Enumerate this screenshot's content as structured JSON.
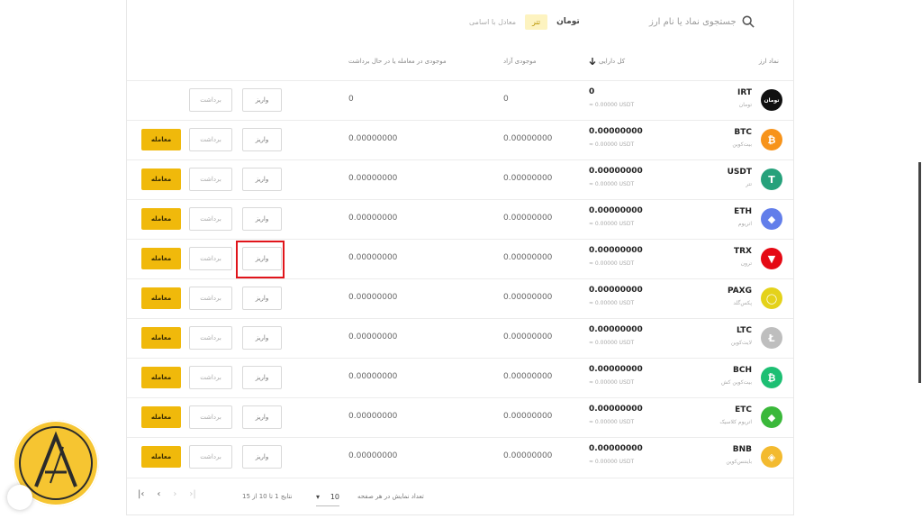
{
  "search": {
    "placeholder": "جستجوی نماد یا نام ارز"
  },
  "filters": [
    {
      "label": "معادل با اسامی",
      "active": false
    },
    {
      "label": "تتر",
      "active": true
    },
    {
      "label": "تومان",
      "active": false
    }
  ],
  "columns": {
    "coin": "نماد ارز",
    "total": "کل دارایی",
    "blocked": "موجودی آزاد",
    "available": "موجودی در معامله یا در حال برداشت"
  },
  "buttons": {
    "deposit": "واریز",
    "withdraw": "برداشت",
    "trade": "معامله"
  },
  "rows": [
    {
      "symbol": "IRT",
      "name": "تومان",
      "balance": "0",
      "sub": "≈ 0.00000 USDT",
      "blocked": "0",
      "available": "0",
      "color": "#111111",
      "glyph": "تومان",
      "trade": false
    },
    {
      "symbol": "BTC",
      "name": "بیت‌کوین",
      "balance": "0.00000000",
      "sub": "≈ 0.00000 USDT",
      "blocked": "0.00000000",
      "available": "0.00000000",
      "color": "#f7931a",
      "glyph": "₿",
      "trade": true
    },
    {
      "symbol": "USDT",
      "name": "تتر",
      "balance": "0.00000000",
      "sub": "≈ 0.00000 USDT",
      "blocked": "0.00000000",
      "available": "0.00000000",
      "color": "#26a17b",
      "glyph": "T",
      "trade": true
    },
    {
      "symbol": "ETH",
      "name": "اتریوم",
      "balance": "0.00000000",
      "sub": "≈ 0.00000 USDT",
      "blocked": "0.00000000",
      "available": "0.00000000",
      "color": "#627eea",
      "glyph": "◆",
      "trade": true
    },
    {
      "symbol": "TRX",
      "name": "ترون",
      "balance": "0.00000000",
      "sub": "≈ 0.00000 USDT",
      "blocked": "0.00000000",
      "available": "0.00000000",
      "color": "#e50914",
      "glyph": "▼",
      "trade": true
    },
    {
      "symbol": "PAXG",
      "name": "پکس‌گلد",
      "balance": "0.00000000",
      "sub": "≈ 0.00000 USDT",
      "blocked": "0.00000000",
      "available": "0.00000000",
      "color": "#e4d21a",
      "glyph": "◯",
      "trade": true
    },
    {
      "symbol": "LTC",
      "name": "لایت‌کوین",
      "balance": "0.00000000",
      "sub": "≈ 0.00000 USDT",
      "blocked": "0.00000000",
      "available": "0.00000000",
      "color": "#bebebe",
      "glyph": "Ł",
      "trade": true
    },
    {
      "symbol": "BCH",
      "name": "بیت‌کوین کش",
      "balance": "0.00000000",
      "sub": "≈ 0.00000 USDT",
      "blocked": "0.00000000",
      "available": "0.00000000",
      "color": "#1dbf73",
      "glyph": "₿",
      "trade": true
    },
    {
      "symbol": "ETC",
      "name": "اتریوم کلاسیک",
      "balance": "0.00000000",
      "sub": "≈ 0.00000 USDT",
      "blocked": "0.00000000",
      "available": "0.00000000",
      "color": "#3ab83a",
      "glyph": "◆",
      "trade": true
    },
    {
      "symbol": "BNB",
      "name": "بایننس‌کوین",
      "balance": "0.00000000",
      "sub": "≈ 0.00000 USDT",
      "blocked": "0.00000000",
      "available": "0.00000000",
      "color": "#f3ba2f",
      "glyph": "◈",
      "trade": true
    }
  ],
  "footer": {
    "per_page_label": "تعداد نمایش در هر صفحه",
    "per_page_value": "10",
    "page_info": "نتایج 1 تا 10 از 15"
  },
  "pager": {
    "first": "|‹",
    "prev": "‹",
    "next": "›",
    "last": "›|"
  },
  "colors": {
    "accent": "#f0b90b",
    "highlight": "#e0151b",
    "logo": "#f6c531"
  }
}
